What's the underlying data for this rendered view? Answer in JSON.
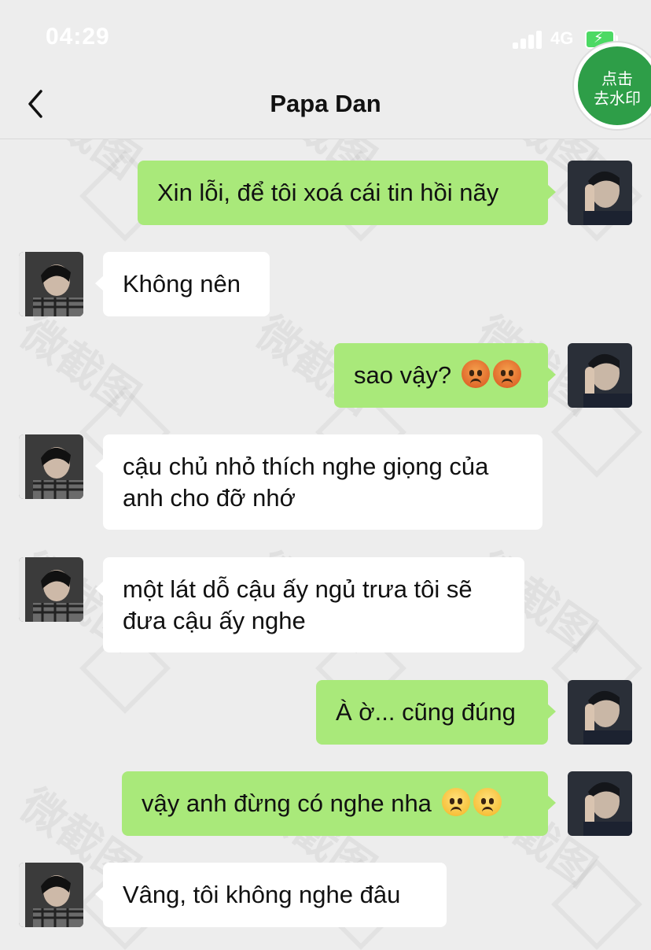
{
  "status_bar": {
    "time": "04:29",
    "network": "4G"
  },
  "nav": {
    "title": "Papa Dan",
    "watermark_button": "点击\n去水印"
  },
  "watermark_text": "微截图",
  "messages": [
    {
      "side": "out",
      "text": "Xin lỗi, để tôi xoá cái tin hồi nãy",
      "emoji": []
    },
    {
      "side": "in",
      "text": "Không nên",
      "emoji": []
    },
    {
      "side": "out",
      "text": "sao vậy?",
      "emoji": [
        "angry-crying-face",
        "angry-crying-face"
      ]
    },
    {
      "side": "in",
      "text": "cậu chủ nhỏ thích nghe giọng của anh cho đỡ nhớ",
      "emoji": []
    },
    {
      "side": "in",
      "text": "một lát dỗ cậu ấy ngủ trưa tôi sẽ đưa cậu ấy nghe",
      "emoji": []
    },
    {
      "side": "out",
      "text": "À ờ... cũng đúng",
      "emoji": []
    },
    {
      "side": "out",
      "text": "vậy anh đừng có nghe nha",
      "emoji": [
        "worried-face",
        "worried-face"
      ]
    },
    {
      "side": "in",
      "text": "Vâng, tôi không nghe đâu",
      "emoji": []
    }
  ],
  "colors": {
    "outgoing_bubble": "#a9e97a",
    "incoming_bubble": "#ffffff",
    "background": "#ededed",
    "watermark_button": "#2e9e48"
  }
}
